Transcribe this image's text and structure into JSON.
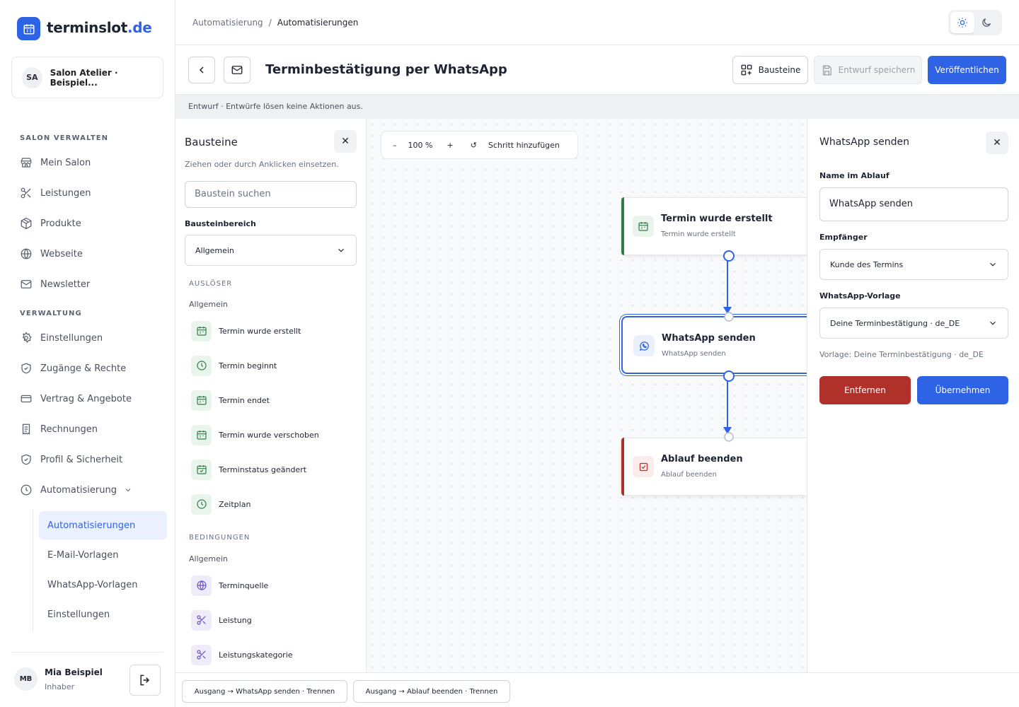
{
  "brand": {
    "name": "terminslot",
    "tld": ".de"
  },
  "salon": {
    "initials": "SA",
    "name": "Salon Atelier · Beispiel..."
  },
  "sidebar": {
    "section1": "SALON VERWALTEN",
    "items1": [
      {
        "label": "Mein Salon",
        "icon": "store-icon"
      },
      {
        "label": "Leistungen",
        "icon": "scissors-icon"
      },
      {
        "label": "Produkte",
        "icon": "package-icon"
      },
      {
        "label": "Webseite",
        "icon": "globe-icon"
      },
      {
        "label": "Newsletter",
        "icon": "mail-icon"
      }
    ],
    "section2": "VERWALTUNG",
    "items2": [
      {
        "label": "Einstellungen",
        "icon": "gear-icon"
      },
      {
        "label": "Zugänge & Rechte",
        "icon": "shield-check-icon"
      },
      {
        "label": "Vertrag & Angebote",
        "icon": "credit-card-icon"
      },
      {
        "label": "Rechnungen",
        "icon": "receipt-icon"
      },
      {
        "label": "Profil & Sicherheit",
        "icon": "shield-icon"
      },
      {
        "label": "Automatisierung",
        "icon": "clock-icon"
      }
    ],
    "subitems": [
      "Automatisierungen",
      "E-Mail-Vorlagen",
      "WhatsApp-Vorlagen",
      "Einstellungen"
    ]
  },
  "user": {
    "initials": "MB",
    "name": "Mia Beispiel",
    "role": "Inhaber"
  },
  "breadcrumb": {
    "parent": "Automatisierung",
    "separator": "/",
    "current": "Automatisierungen"
  },
  "header": {
    "title": "Terminbestätigung per WhatsApp",
    "blocks_button": "Bausteine",
    "save_button": "Entwurf speichern",
    "publish_button": "Veröffentlichen"
  },
  "draft_notice": "Entwurf · Entwürfe lösen keine Aktionen aus.",
  "palette": {
    "title": "Bausteine",
    "close": "✕",
    "hint": "Ziehen oder durch Anklicken einsetzen.",
    "search_placeholder": "Baustein suchen",
    "area_label": "Bausteinbereich",
    "area_value": "Allgemein",
    "triggers_heading": "AUSLÖSER",
    "triggers_sub": "Allgemein",
    "triggers": [
      {
        "label": "Termin wurde erstellt",
        "icon": "calendar-icon"
      },
      {
        "label": "Termin beginnt",
        "icon": "clock-icon"
      },
      {
        "label": "Termin endet",
        "icon": "calendar-icon"
      },
      {
        "label": "Termin wurde verschoben",
        "icon": "calendar-icon"
      },
      {
        "label": "Terminstatus geändert",
        "icon": "calendar-check-icon"
      },
      {
        "label": "Zeitplan",
        "icon": "clock-icon"
      }
    ],
    "conditions_heading": "BEDINGUNGEN",
    "conditions_sub": "Allgemein",
    "conditions": [
      {
        "label": "Terminquelle",
        "icon": "globe-icon"
      },
      {
        "label": "Leistung",
        "icon": "scissors-icon"
      },
      {
        "label": "Leistungskategorie",
        "icon": "scissors-icon"
      }
    ]
  },
  "canvas": {
    "zoom_out": "–",
    "zoom": "100 %",
    "zoom_in": "+",
    "reset": "↺",
    "add_step": "Schritt hinzufügen",
    "nodes": [
      {
        "title": "Termin wurde erstellt",
        "subtitle": "Termin wurde erstellt",
        "accent": "#2e7d46"
      },
      {
        "title": "WhatsApp senden",
        "subtitle": "WhatsApp senden",
        "accent": "#2f63e6"
      },
      {
        "title": "Ablauf beenden",
        "subtitle": "Ablauf beenden",
        "accent": "#b0312a"
      }
    ]
  },
  "inspector": {
    "title": "WhatsApp senden",
    "close": "✕",
    "name_label": "Name im Ablauf",
    "name_value": "WhatsApp senden",
    "recipient_label": "Empfänger",
    "recipient_value": "Kunde des Termins",
    "template_label": "WhatsApp-Vorlage",
    "template_value": "Deine Terminbestätigung · de_DE",
    "template_note": "Vorlage: Deine Terminbestätigung · de_DE",
    "remove_button": "Entfernen",
    "apply_button": "Übernehmen"
  },
  "connections": [
    "Ausgang → WhatsApp senden · Trennen",
    "Ausgang → Ablauf beenden · Trennen"
  ],
  "colors": {
    "primary": "#2f63e6",
    "danger": "#b0312a",
    "trigger": "#2e7d46"
  }
}
